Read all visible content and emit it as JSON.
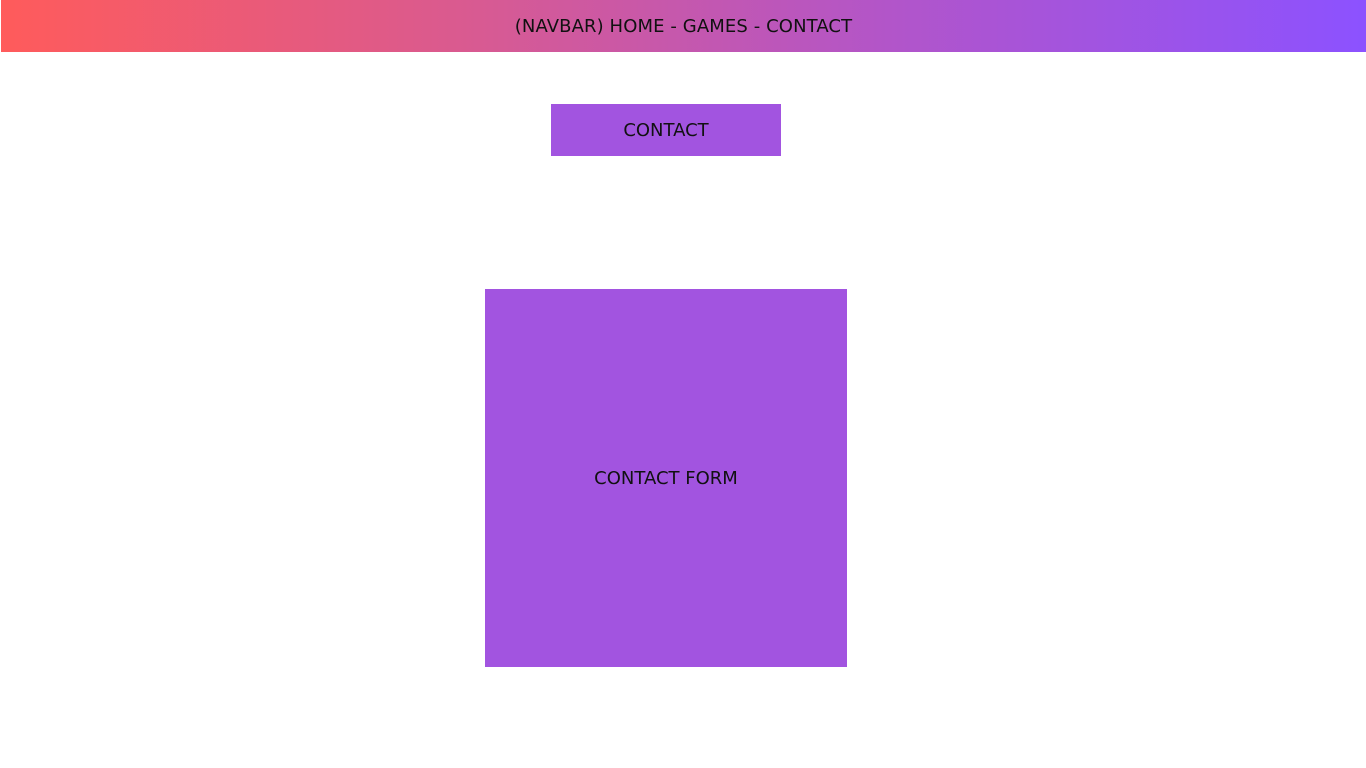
{
  "navbar": {
    "text": "(NAVBAR) HOME - GAMES - CONTACT",
    "gradient_start": "#ff5b5b",
    "gradient_end": "#8c52ff"
  },
  "contact_heading": {
    "label": "CONTACT",
    "background": "#a254e0"
  },
  "contact_form": {
    "label": "CONTACT FORM",
    "background": "#a254e0"
  }
}
